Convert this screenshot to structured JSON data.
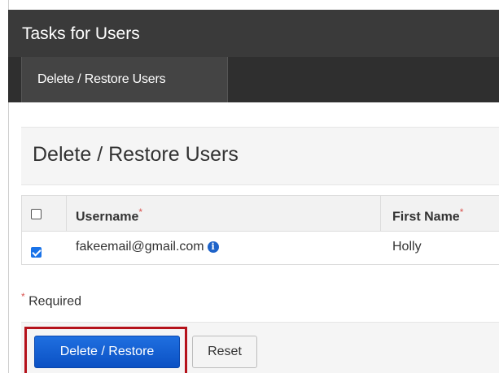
{
  "header": {
    "title": "Tasks for Users"
  },
  "tabs": [
    {
      "label": "Delete / Restore Users",
      "active": true
    }
  ],
  "panel": {
    "title": "Delete / Restore Users"
  },
  "table": {
    "columns": [
      {
        "label": "Username",
        "required_mark": "*"
      },
      {
        "label": "First Name",
        "required_mark": "*"
      }
    ],
    "select_all_checked": false,
    "rows": [
      {
        "checked": true,
        "username": "fakeemail@gmail.com",
        "first_name": "Holly",
        "info_icon": "info-icon"
      }
    ]
  },
  "required_note": {
    "mark": "*",
    "text": "Required"
  },
  "actions": {
    "primary_label": "Delete / Restore",
    "secondary_label": "Reset"
  },
  "colors": {
    "header_bg": "#3a3a3a",
    "primary_button": "#1565d8",
    "required_mark": "#d9534f",
    "highlight_box": "#b5121b"
  }
}
